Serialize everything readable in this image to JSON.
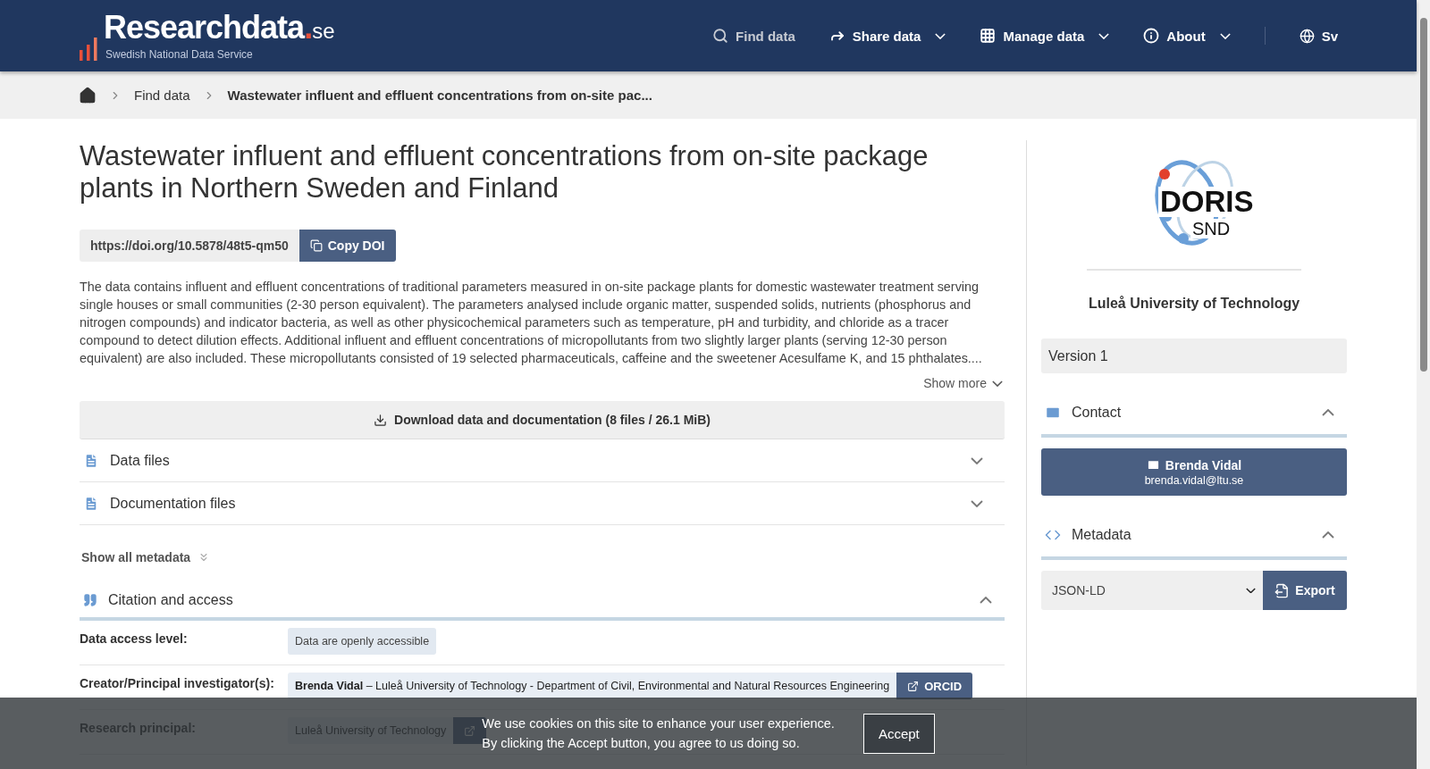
{
  "header": {
    "logo": {
      "name": "Researchdata",
      "dot": ".",
      "tld": "se",
      "tagline": "Swedish National Data Service"
    },
    "nav": [
      {
        "label": "Find data",
        "dropdown": false,
        "selected": true
      },
      {
        "label": "Share data",
        "dropdown": true,
        "selected": false
      },
      {
        "label": "Manage data",
        "dropdown": true,
        "selected": false
      },
      {
        "label": "About",
        "dropdown": true,
        "selected": false
      }
    ],
    "language": {
      "label": "Sv",
      "selected": false
    }
  },
  "breadcrumb": [
    "Find data",
    "Wastewater influent and effluent concentrations from on-site pac..."
  ],
  "dataset": {
    "title": "Wastewater influent and effluent concentrations from on-site package plants in Northern Sweden and Finland",
    "doi": "https://doi.org/10.5878/48t5-qm50",
    "copy_button": "Copy DOI",
    "description": "The data contains influent and effluent concentrations of traditional parameters measured in on-site package plants for domestic wastewater treatment serving single houses or small communities (2-30 person equivalent). The parameters analysed include organic matter, suspended solids, nutrients (phosphorus and nitrogen compounds) and indicator bacteria, as well as other physicochemical parameters such as temperature, pH and turbidity, and chloride as a tracer compound to detect dilution effects. Additional influent and effluent concentrations of micropollutants from two slightly larger plants (serving 12-30 person equivalent) are also included. These micropollutants consisted of 19 selected pharmaceuticals, caffeine and the sweetener Acesulfame K, and 15 phthalates....",
    "show_more": "Show more",
    "download_button": "Download data and documentation (8 files / 26.1 MiB)",
    "sections": [
      {
        "title": "Data files",
        "expanded": false
      },
      {
        "title": "Documentation files",
        "expanded": false
      }
    ],
    "show_all_metadata": "Show all metadata",
    "citation": {
      "title": "Citation and access",
      "expanded": true,
      "rows": [
        {
          "kind": "tag",
          "label": "Data access level:",
          "value": "Data are openly accessible"
        },
        {
          "kind": "person",
          "label": "Creator/Principal investigator(s):",
          "value": "**Brenda Vidal**  –  Luleå University of Technology - Department of Civil, Environmental and Natural Resources Engineering",
          "button": "ORCID"
        },
        {
          "kind": "org",
          "label": "Research principal:",
          "value": "Luleå University of Technology"
        }
      ]
    }
  },
  "sidebar": {
    "logo": {
      "name": "DORIS",
      "sub": "SND"
    },
    "organisation": "Luleå University of Technology",
    "version": "Version 1",
    "contact": {
      "title": "Contact",
      "expanded": true,
      "name": "Brenda Vidal",
      "email": "brenda.vidal@ltu.se"
    },
    "metadata": {
      "title": "Metadata",
      "expanded": true,
      "format": "JSON-LD",
      "export": "Export"
    }
  },
  "cookie_banner": {
    "lines": [
      "We use cookies on this site to enhance your user experience.",
      "By clicking the Accept button, you agree to us doing so."
    ],
    "accept": "Accept"
  }
}
